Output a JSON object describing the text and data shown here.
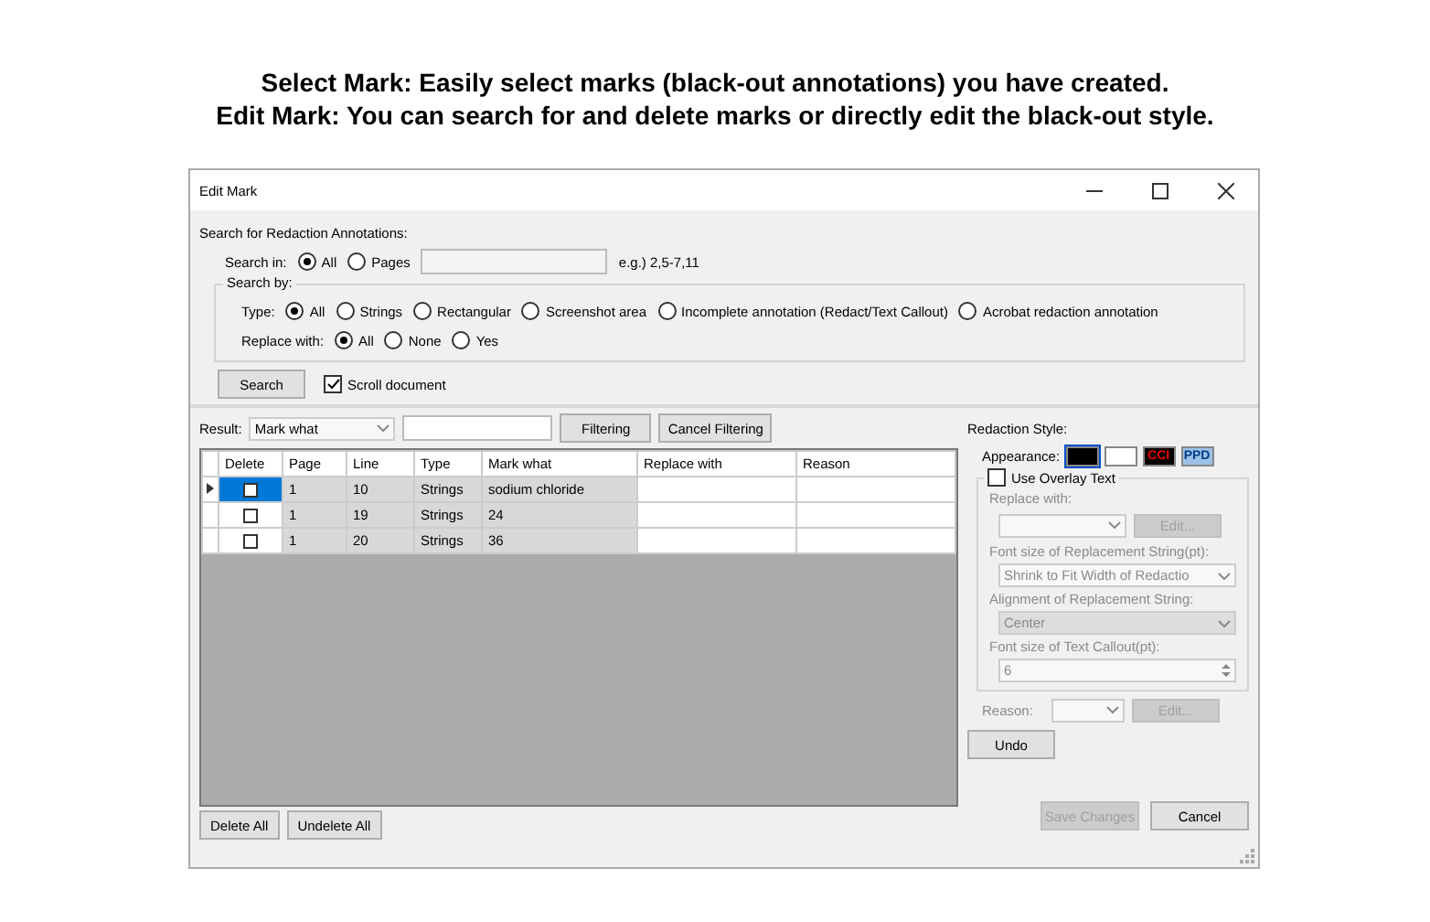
{
  "heading": [
    "Select Mark: Easily select marks (black-out annotations) you have created.",
    "Edit Mark: You can search for and delete marks or directly edit the black-out style."
  ],
  "window": {
    "title": "Edit Mark"
  },
  "search": {
    "label": "Search for Redaction Annotations:",
    "search_in": {
      "label": "Search in:",
      "options": [
        {
          "label": "All",
          "selected": true
        },
        {
          "label": "Pages",
          "selected": false
        }
      ],
      "hint": "e.g.) 2,5-7,11"
    },
    "search_by": {
      "label": "Search by:",
      "type": {
        "label": "Type:",
        "options": [
          {
            "label": "All",
            "selected": true
          },
          {
            "label": "Strings",
            "selected": false
          },
          {
            "label": "Rectangular",
            "selected": false
          },
          {
            "label": "Screenshot area",
            "selected": false
          },
          {
            "label": "Incomplete annotation (Redact/Text Callout)",
            "selected": false
          },
          {
            "label": "Acrobat redaction annotation",
            "selected": false
          }
        ]
      },
      "replace_with": {
        "label": "Replace with:",
        "options": [
          {
            "label": "All",
            "selected": true
          },
          {
            "label": "None",
            "selected": false
          },
          {
            "label": "Yes",
            "selected": false
          }
        ]
      }
    },
    "search_button": "Search",
    "scroll_document": {
      "label": "Scroll document",
      "checked": true
    }
  },
  "result": {
    "label": "Result:",
    "field": "Mark what",
    "filter_button": "Filtering",
    "cancel_filter_button": "Cancel Filtering"
  },
  "table": {
    "columns": [
      "Delete",
      "Page",
      "Line",
      "Type",
      "Mark what",
      "Replace with",
      "Reason"
    ],
    "rows": [
      {
        "selected": true,
        "delete": false,
        "page": "1",
        "line": "10",
        "type": "Strings",
        "mark_what": "sodium chloride"
      },
      {
        "selected": false,
        "delete": false,
        "page": "1",
        "line": "19",
        "type": "Strings",
        "mark_what": "24"
      },
      {
        "selected": false,
        "delete": false,
        "page": "1",
        "line": "20",
        "type": "Strings",
        "mark_what": "36"
      }
    ]
  },
  "bottom_buttons": [
    "Delete All",
    "Undelete All"
  ],
  "style": {
    "title": "Redaction Style:",
    "appearance_label": "Appearance:",
    "swatches": [
      {
        "kind": "fill",
        "color": "#000000",
        "selected": true
      },
      {
        "kind": "fill",
        "color": "#ffffff",
        "selected": false
      },
      {
        "kind": "text",
        "label": "CCI",
        "color": "#000000",
        "selected": false
      },
      {
        "kind": "text",
        "label": "PPD",
        "color": "#9cc3e6",
        "selected": false
      }
    ],
    "overlay": {
      "label": "Use Overlay Text",
      "checked": false,
      "disabled": true,
      "replace_with_label": "Replace with:",
      "edit_button": "Edit...",
      "font_size_label": "Font size of Replacement String(pt):",
      "font_size_value": "Shrink to Fit Width of Redactio",
      "alignment_label": "Alignment of Replacement String:",
      "alignment_value": "Center",
      "callout_label": "Font size of Text Callout(pt):",
      "callout_value": "6"
    },
    "reason_label": "Reason:",
    "reason_edit_button": "Edit...",
    "undo_button": "Undo"
  },
  "footer": [
    {
      "label": "Save Changes",
      "disabled": true
    },
    {
      "label": "Cancel",
      "disabled": false
    }
  ]
}
